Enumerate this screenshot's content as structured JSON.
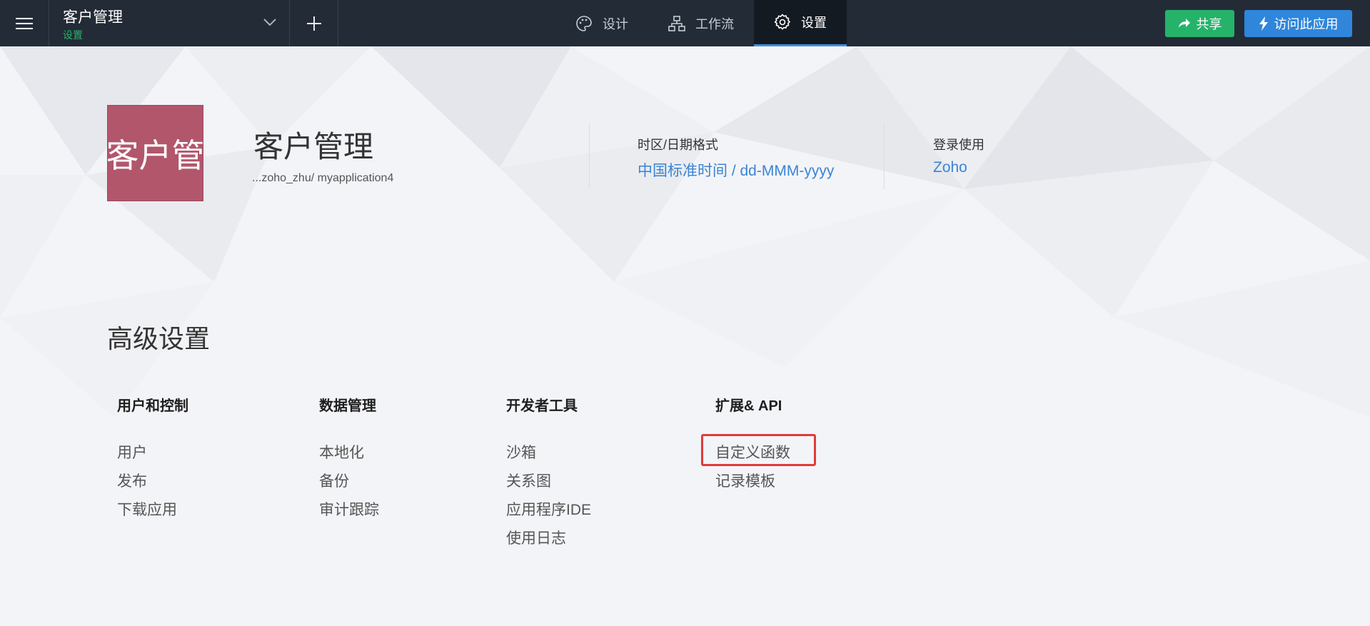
{
  "topbar": {
    "app_name": "客户管理",
    "app_subtitle": "设置",
    "tabs": [
      {
        "label": "设计",
        "icon": "palette-icon",
        "active": false
      },
      {
        "label": "工作流",
        "icon": "workflow-icon",
        "active": false
      },
      {
        "label": "设置",
        "icon": "gear-icon",
        "active": true
      }
    ],
    "share_label": "共享",
    "visit_label": "访问此应用"
  },
  "app": {
    "logo_text": "客户管",
    "title": "客户管理",
    "path": "...zoho_zhu/ myapplication4",
    "timezone_label": "时区/日期格式",
    "timezone_value": "中国标准时间 / dd-MMM-yyyy",
    "login_label": "登录使用",
    "login_value": "Zoho"
  },
  "advanced": {
    "title": "高级设置",
    "columns": [
      {
        "heading": "用户和控制",
        "items": [
          "用户",
          "发布",
          "下载应用"
        ]
      },
      {
        "heading": "数据管理",
        "items": [
          "本地化",
          "备份",
          "审计跟踪"
        ]
      },
      {
        "heading": "开发者工具",
        "items": [
          "沙箱",
          "关系图",
          "应用程序IDE",
          "使用日志"
        ]
      },
      {
        "heading": "扩展& API",
        "items": [
          "自定义函数",
          "记录模板"
        ]
      }
    ]
  },
  "colors": {
    "topbar_bg": "#232b37",
    "accent_green": "#25b36a",
    "accent_blue": "#2f86db",
    "link_blue": "#3a84d4",
    "logo_bg": "#b2566c",
    "highlight_red": "#e03b3b"
  }
}
